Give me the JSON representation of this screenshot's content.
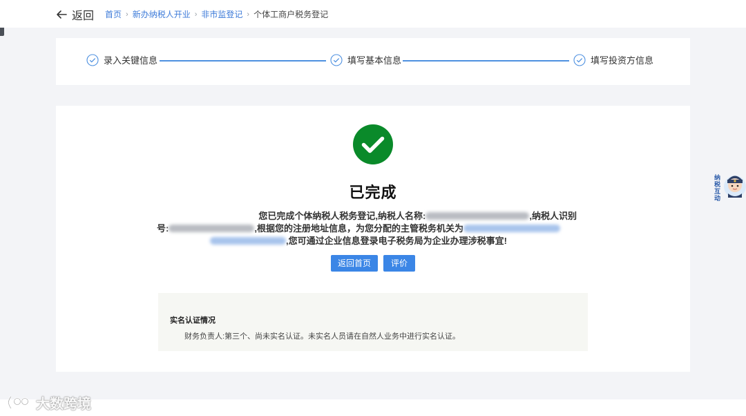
{
  "header": {
    "back_label": "返回",
    "breadcrumb": [
      "首页",
      "新办纳税人开业",
      "非市监登记",
      "个体工商户税务登记"
    ],
    "breadcrumb_sep": "›"
  },
  "steps": [
    {
      "label": "录入关键信息",
      "status": "done"
    },
    {
      "label": "填写基本信息",
      "status": "done"
    },
    {
      "label": "填写投资方信息",
      "status": "done"
    }
  ],
  "result": {
    "title": "已完成",
    "msg_line1_a": "您已完成个体纳税人税务登记,纳税人名称:",
    "msg_line1_b": ",纳税人识别",
    "msg_line2_a": "号:",
    "msg_line2_b": ",根据您的注册地址信息，为您分配的主管税务机关为",
    "msg_line3_b": ",您可通过企业信息登录电子税务局为企业办理涉税事宜!",
    "btn_home": "返回首页",
    "btn_rate": "评价"
  },
  "auth": {
    "title": "实名认证情况",
    "text": "财务负责人:第三个、尚未实名认证。未实名人员请在自然人业务中进行实名认证。"
  },
  "helper": {
    "label": "纳税互动",
    "icon": "assistant-avatar-icon"
  },
  "watermark": {
    "text": "大数跨境",
    "icon": "brand-logo-icon"
  },
  "colors": {
    "accent": "#3b86e6",
    "success": "#0a8a2a",
    "link": "#3d7bd9"
  }
}
